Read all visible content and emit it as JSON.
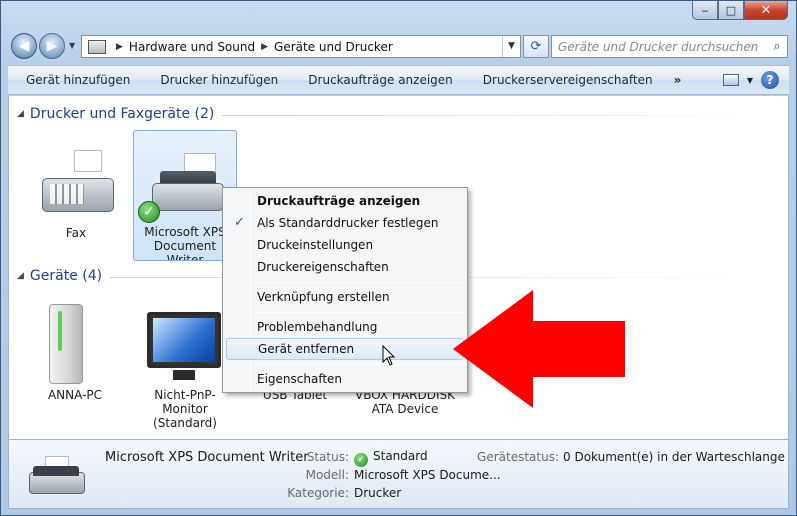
{
  "window": {
    "minimize_glyph": "‒",
    "maximize_glyph": "□",
    "close_glyph": "✕"
  },
  "nav": {
    "back_glyph": "◀",
    "forward_glyph": "▶",
    "breadcrumb": [
      "Hardware und Sound",
      "Geräte und Drucker"
    ],
    "search_placeholder": "Geräte und Drucker durchsuchen"
  },
  "toolbar": {
    "items": [
      "Gerät hinzufügen",
      "Drucker hinzufügen",
      "Druckaufträge anzeigen",
      "Druckerservereigenschaften"
    ],
    "more": "»",
    "help": "?"
  },
  "groups": {
    "printers": {
      "title": "Drucker und Faxgeräte (2)",
      "devices": [
        {
          "label": "Fax"
        },
        {
          "label": "Microsoft XPS Document Writer",
          "default": true
        }
      ]
    },
    "devices": {
      "title": "Geräte (4)",
      "devices": [
        {
          "label": "ANNA-PC"
        },
        {
          "label": "Nicht-PnP-Monitor (Standard)"
        },
        {
          "label": "USB Tablet"
        },
        {
          "label": "VBOX HARDDISK ATA Device"
        }
      ]
    }
  },
  "context_menu": {
    "items": [
      {
        "label": "Druckaufträge anzeigen",
        "bold": true
      },
      {
        "label": "Als Standarddrucker festlegen",
        "checked": true
      },
      {
        "label": "Druckeinstellungen"
      },
      {
        "label": "Druckereigenschaften"
      },
      {
        "label": "Verknüpfung erstellen"
      },
      {
        "label": "Problembehandlung"
      },
      {
        "label": "Gerät entfernen",
        "hovered": true
      },
      {
        "label": "Eigenschaften"
      }
    ]
  },
  "details": {
    "name": "Microsoft XPS Document Writer",
    "status_label": "Status:",
    "status_value": "Standard",
    "model_label": "Modell:",
    "model_value": "Microsoft XPS Docume...",
    "category_label": "Kategorie:",
    "category_value": "Drucker",
    "device_status_label": "Gerätestatus:",
    "device_status_value": "0 Dokument(e) in der Warteschlange"
  },
  "colors": {
    "group_title": "#1e3f8f",
    "annotation_arrow": "#ff0000",
    "default_check": "#1f8a1e"
  }
}
